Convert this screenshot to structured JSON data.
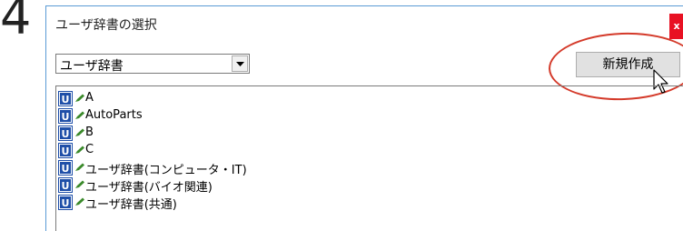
{
  "step_number": "4",
  "dialog": {
    "title": "ユーザ辞書の選択",
    "close_label": "x",
    "dropdown": {
      "selected": "ユーザ辞書"
    },
    "new_button_label": "新規作成",
    "dictionaries": [
      {
        "label": "A"
      },
      {
        "label": "AutoParts"
      },
      {
        "label": "B"
      },
      {
        "label": "C"
      },
      {
        "label": "ユーザ辞書(コンピュータ・IT)"
      },
      {
        "label": "ユーザ辞書(バイオ関連)"
      },
      {
        "label": "ユーザ辞書(共通)"
      }
    ]
  },
  "colors": {
    "highlight_ellipse": "#d43a2a",
    "close_button": "#e81123",
    "icon_blue": "#1f4fa8"
  },
  "icons": {
    "dictionary": "user-dictionary-icon",
    "edit": "pencil-icon",
    "pointer": "mouse-cursor-icon"
  }
}
